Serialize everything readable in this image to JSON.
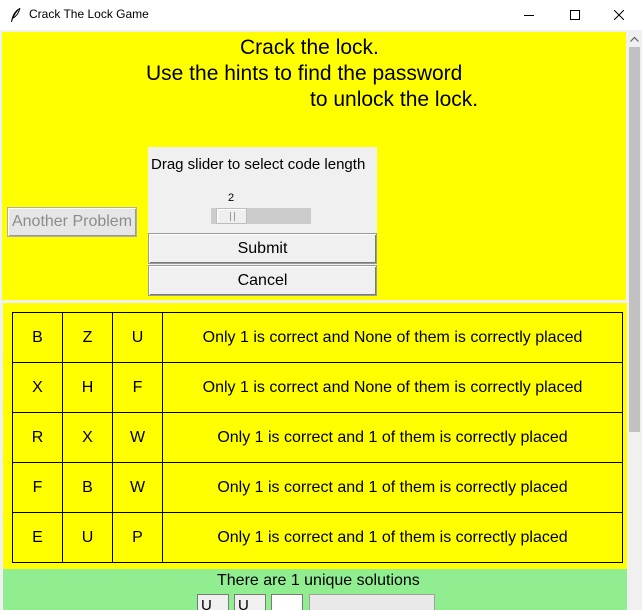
{
  "window": {
    "title": "Crack The Lock Game",
    "icon": "feather-icon",
    "controls": [
      "minimize-icon",
      "maximize-icon",
      "close-icon"
    ]
  },
  "colors": {
    "panel_yellow": "#ffff00",
    "solution_green": "#90ee90",
    "dialog_gray": "#f0f0f0"
  },
  "header": {
    "line1": "Crack the lock.",
    "line2": "Use the hints to find the password",
    "line3": "to unlock the lock."
  },
  "another_problem_label": "Another Problem",
  "dialog": {
    "label": "Drag slider to select code length",
    "slider_value": "2",
    "submit_label": "Submit",
    "cancel_label": "Cancel"
  },
  "hints": [
    {
      "c1": "B",
      "c2": "Z",
      "c3": "U",
      "desc": "Only 1 is correct and None of them is correctly placed"
    },
    {
      "c1": "X",
      "c2": "H",
      "c3": "F",
      "desc": "Only 1 is correct and None of them is correctly placed"
    },
    {
      "c1": "R",
      "c2": "X",
      "c3": "W",
      "desc": "Only 1 is correct and 1 of them is correctly placed"
    },
    {
      "c1": "F",
      "c2": "B",
      "c3": "W",
      "desc": "Only 1 is correct and 1 of them is correctly placed"
    },
    {
      "c1": "E",
      "c2": "U",
      "c3": "P",
      "desc": "Only 1 is correct and 1 of them is correctly placed"
    }
  ],
  "solutions": {
    "text": "There are 1 unique solutions",
    "code": [
      "U",
      "U",
      ""
    ]
  }
}
